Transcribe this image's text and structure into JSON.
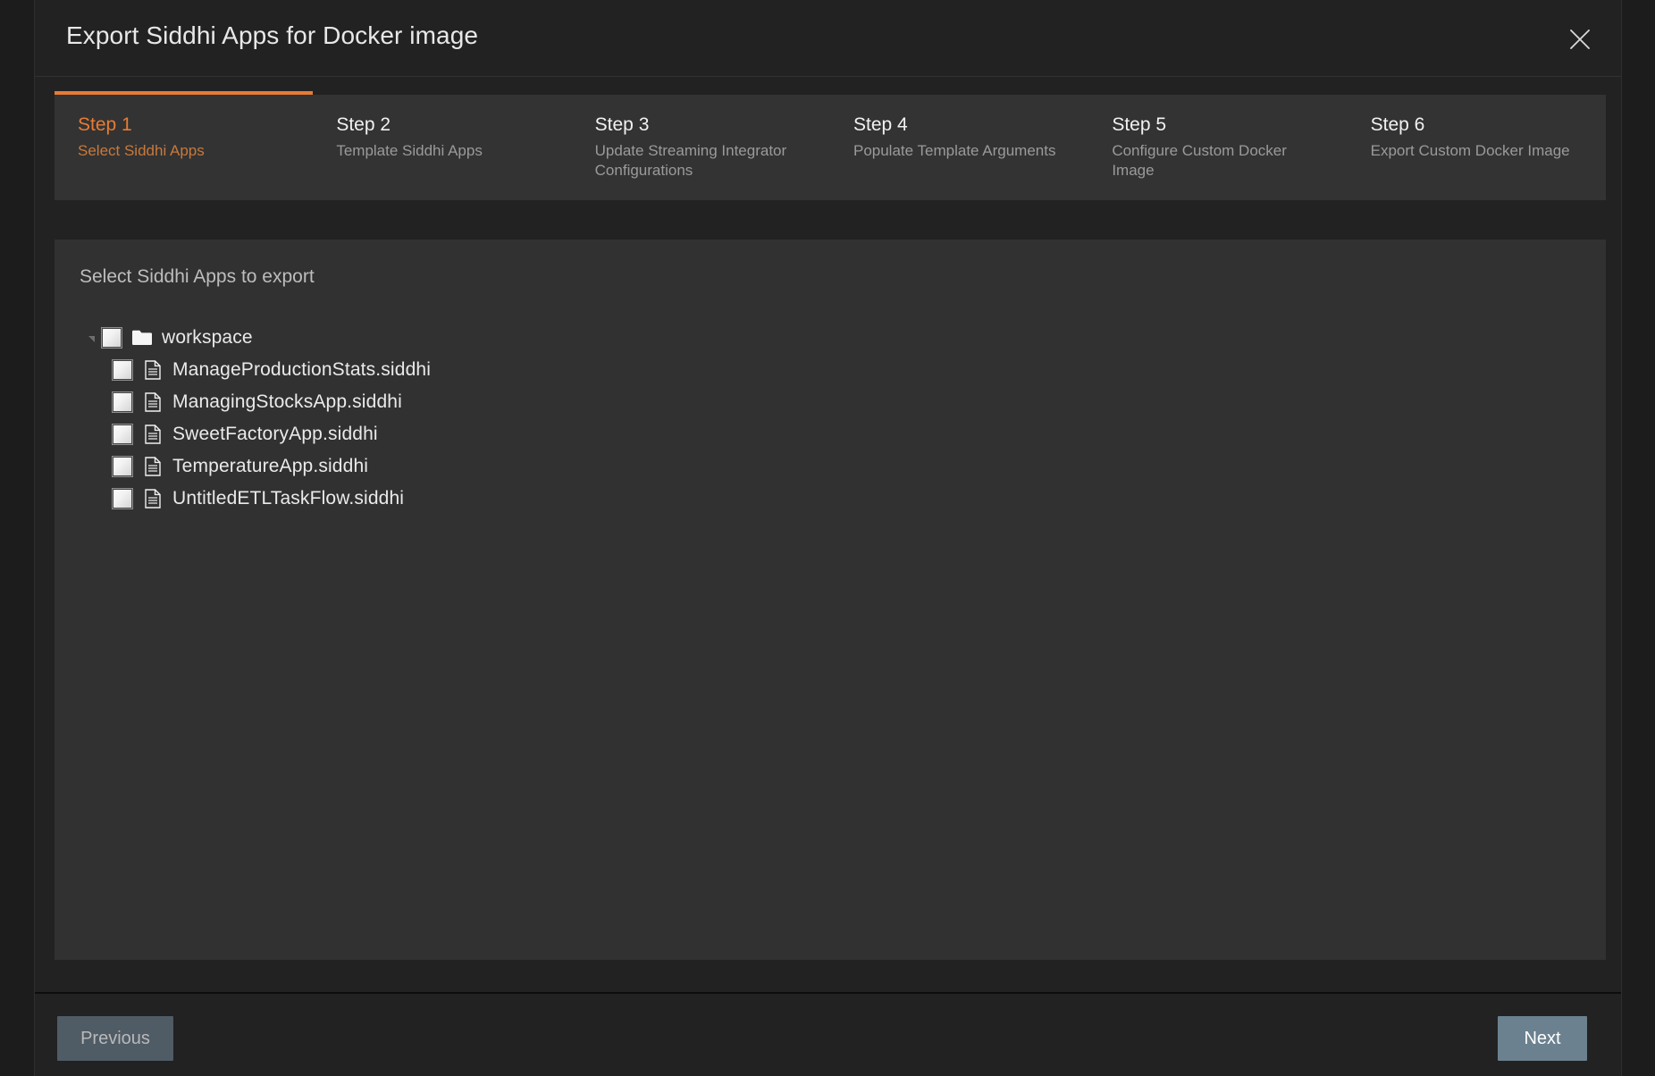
{
  "dialog": {
    "title": "Export Siddhi Apps for Docker image",
    "close_icon": "close-icon"
  },
  "stepper": {
    "steps": [
      {
        "number": "Step 1",
        "label": "Select Siddhi Apps",
        "active": true
      },
      {
        "number": "Step 2",
        "label": "Template Siddhi Apps",
        "active": false
      },
      {
        "number": "Step 3",
        "label": "Update Streaming Integrator Configurations",
        "active": false
      },
      {
        "number": "Step 4",
        "label": "Populate Template Arguments",
        "active": false
      },
      {
        "number": "Step 5",
        "label": "Configure Custom Docker Image",
        "active": false
      },
      {
        "number": "Step 6",
        "label": "Export Custom Docker Image",
        "active": false
      }
    ],
    "active_color": "#e87b35"
  },
  "panel": {
    "heading": "Select Siddhi Apps to export",
    "tree": {
      "root": {
        "label": "workspace",
        "icon": "folder-icon",
        "checked": false,
        "expanded": true
      },
      "children": [
        {
          "label": "ManageProductionStats.siddhi",
          "icon": "file-icon",
          "checked": false
        },
        {
          "label": "ManagingStocksApp.siddhi",
          "icon": "file-icon",
          "checked": false
        },
        {
          "label": "SweetFactoryApp.siddhi",
          "icon": "file-icon",
          "checked": false
        },
        {
          "label": "TemperatureApp.siddhi",
          "icon": "file-icon",
          "checked": false
        },
        {
          "label": "UntitledETLTaskFlow.siddhi",
          "icon": "file-icon",
          "checked": false
        }
      ]
    }
  },
  "footer": {
    "previous_label": "Previous",
    "next_label": "Next",
    "previous_color": "#4f5b65",
    "next_color": "#6b818f"
  }
}
